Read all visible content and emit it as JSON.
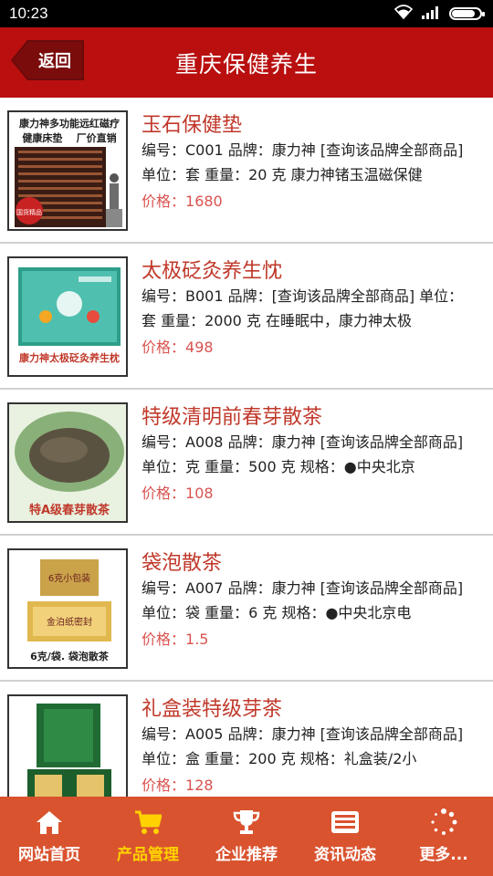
{
  "status": {
    "time": "10:23",
    "battery_level": 0.82
  },
  "header": {
    "back_label": "返回",
    "title": "重庆保健养生"
  },
  "products": [
    {
      "name": "玉石保健垫",
      "desc": "编号：C001 品牌：康力神 [查询该品牌全部商品] 单位：套 重量：20 克 康力神锗玉温磁保健",
      "price_label": "价格：",
      "price": "1680",
      "image_text": [
        "康力神多功能远红磁疗",
        "健康床垫    厂价直销",
        "国货精品"
      ]
    },
    {
      "name": "太极砭灸养生忱",
      "desc": "编号：B001 品牌：[查询该品牌全部商品] 单位：套 重量：2000 克 在睡眠中，康力神太极",
      "price_label": "价格：",
      "price": "498",
      "image_text": [
        "康力神太极砭灸养生枕"
      ]
    },
    {
      "name": "特级清明前春芽散茶",
      "desc": "编号：A008 品牌：康力神 [查询该品牌全部商品] 单位：克 重量：500 克 规格：●中央北京",
      "price_label": "价格：",
      "price": "108",
      "image_text": [
        "特A级春芽散茶"
      ]
    },
    {
      "name": "袋泡散茶",
      "desc": "编号：A007 品牌：康力神 [查询该品牌全部商品] 单位：袋 重量：6 克 规格：●中央北京电",
      "price_label": "价格：",
      "price": "1.5",
      "image_text": [
        "6克小包装",
        "金泊纸密封",
        "6克/袋. 袋泡散茶"
      ]
    },
    {
      "name": "礼盒装特级芽茶",
      "desc": "编号：A005 品牌：康力神 [查询该品牌全部商品] 单位：盒 重量：200 克 规格：礼盒装/2小",
      "price_label": "价格：",
      "price": "128",
      "image_text": []
    }
  ],
  "nav": [
    {
      "label": "网站首页",
      "icon": "home-icon",
      "active": false
    },
    {
      "label": "产品管理",
      "icon": "cart-icon",
      "active": true
    },
    {
      "label": "企业推荐",
      "icon": "trophy-icon",
      "active": false
    },
    {
      "label": "资讯动态",
      "icon": "news-icon",
      "active": false
    },
    {
      "label": "更多...",
      "icon": "more-icon",
      "active": false
    }
  ],
  "colors": {
    "header_bg": "#b90f0f",
    "nav_bg": "#d9532f",
    "nav_active": "#ffd200",
    "product_name": "#c0392b",
    "price": "#d9534f"
  }
}
